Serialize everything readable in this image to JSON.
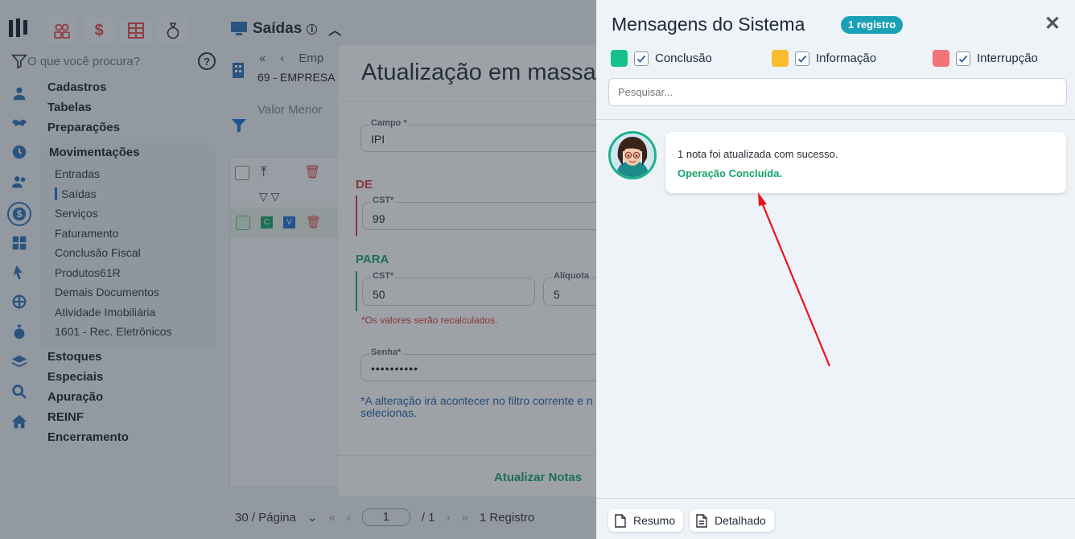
{
  "app": {
    "search_placeholder": "O que você procura?",
    "help": "?",
    "menu_top": [
      "Cadastros",
      "Tabelas",
      "Preparações"
    ],
    "submenu_title": "Movimentações",
    "submenu_items": [
      "Entradas",
      "Saídas",
      "Serviços",
      "Faturamento",
      "Conclusão Fiscal",
      "Produtos61R",
      "Demais Documentos",
      "Atividade Imobiliária",
      "1601 - Rec. Eletrônicos"
    ],
    "menu_bottom": [
      "Estoques",
      "Especiais",
      "Apuração",
      "REINF",
      "Encerramento"
    ],
    "page_title": "Saídas",
    "emp_nav_first": "«",
    "emp_nav_prev": "‹",
    "emp_nav_label": "Emp",
    "emp_name": "69 - EMPRESA",
    "valor_menor": "Valor Menor",
    "pager_size": "30 / Página",
    "pager_page": "1",
    "pager_total": "/ 1",
    "pager_records": "1 Registro"
  },
  "modal": {
    "title": "Atualização em massa",
    "campo_label": "Campo *",
    "campo_value": "IPI",
    "de_label": "DE",
    "de_cst_label": "CST*",
    "de_cst_value": "99",
    "para_label": "PARA",
    "para_cst_label": "CST*",
    "para_cst_value": "50",
    "aliquota_label": "Alíquota",
    "aliquota_value": "5",
    "recalc_note": "*Os valores serão recalculados.",
    "senha_label": "Senha*",
    "senha_value": "••••••••••",
    "filter_note_1": "*A alteração irá acontecer no filtro corrente e n",
    "filter_note_2": "selecionas.",
    "update_button": "Atualizar Notas"
  },
  "panel": {
    "title": "Mensagens do Sistema",
    "badge": "1 registro",
    "close": "✕",
    "filters": [
      {
        "label": "Conclusão",
        "color": "#16c08a",
        "checked": true
      },
      {
        "label": "Informação",
        "color": "#fbbd2e",
        "checked": true
      },
      {
        "label": "Interrupção",
        "color": "#f2737a",
        "checked": true
      }
    ],
    "search_placeholder": "Pesquisar...",
    "message_text": "1 nota foi atualizada com sucesso.",
    "message_status": "Operação Concluída.",
    "btn_resumo": "Resumo",
    "btn_detalhado": "Detalhado"
  },
  "colors": {
    "accent": "#1aa1b8",
    "success": "#16a36a",
    "danger": "#d23b3b",
    "annotation_arrow": "#e8141a"
  }
}
